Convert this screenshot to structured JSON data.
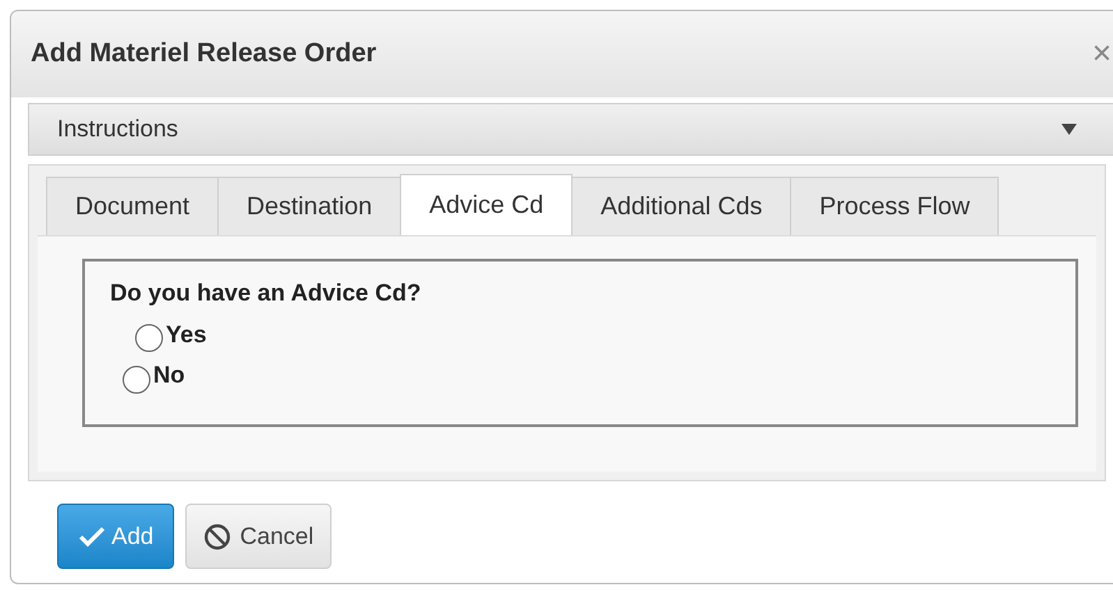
{
  "dialog": {
    "title": "Add Materiel Release Order",
    "close": "×"
  },
  "instructions": {
    "label": "Instructions",
    "expanded": false
  },
  "tabs": [
    {
      "label": "Document",
      "selected": false
    },
    {
      "label": "Destination",
      "selected": false
    },
    {
      "label": "Advice Cd",
      "selected": true
    },
    {
      "label": "Additional Cds",
      "selected": false
    },
    {
      "label": "Process Flow",
      "selected": false
    }
  ],
  "question": {
    "label": "Do you have an Advice Cd?",
    "options": [
      {
        "label": "Yes",
        "selected": false
      },
      {
        "label": "No",
        "selected": false
      }
    ]
  },
  "buttons": [
    {
      "kind": "primary",
      "label": "Add"
    },
    {
      "kind": "cancel",
      "label": "Cancel"
    }
  ]
}
